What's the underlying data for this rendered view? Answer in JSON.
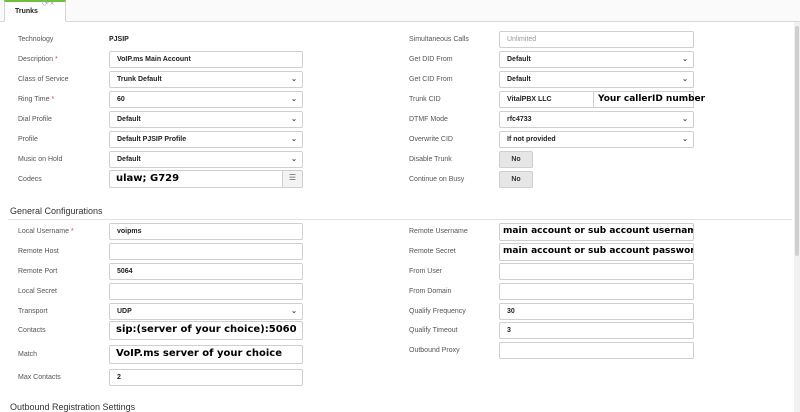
{
  "tab": {
    "label": "Trunks"
  },
  "left": {
    "technology": {
      "label": "Technology",
      "value": "PJSIP"
    },
    "description": {
      "label": "Description",
      "value": "VoIP.ms Main Account"
    },
    "class_of_service": {
      "label": "Class of Service",
      "value": "Trunk Default"
    },
    "ring_time": {
      "label": "Ring Time",
      "value": "60"
    },
    "dial_profile": {
      "label": "Dial Profile",
      "value": "Default"
    },
    "profile": {
      "label": "Profile",
      "value": "Default PJSIP Profile"
    },
    "music_on_hold": {
      "label": "Music on Hold",
      "value": "Default"
    },
    "codecs": {
      "label": "Codecs",
      "value": "ulaw; G729"
    }
  },
  "right": {
    "simultaneous_calls": {
      "label": "Simultaneous Calls",
      "placeholder": "Unlimited"
    },
    "get_did_from": {
      "label": "Get DID From",
      "value": "Default"
    },
    "get_cid_from": {
      "label": "Get CID From",
      "value": "Default"
    },
    "trunk_cid": {
      "label": "Trunk CID",
      "value": "VitalPBX LLC",
      "note": "Your callerID number"
    },
    "dtmf_mode": {
      "label": "DTMF Mode",
      "value": "rfc4733"
    },
    "overwrite_cid": {
      "label": "Overwrite CID",
      "value": "If not provided"
    },
    "disable_trunk": {
      "label": "Disable Trunk",
      "value": "No"
    },
    "continue_on_busy": {
      "label": "Continue on Busy",
      "value": "No"
    }
  },
  "general": {
    "title": "General Configurations",
    "local_username": {
      "label": "Local Username",
      "value": "voipms"
    },
    "remote_host": {
      "label": "Remote Host",
      "value": ""
    },
    "remote_port": {
      "label": "Remote Port",
      "value": "5064"
    },
    "local_secret": {
      "label": "Local Secret",
      "value": ""
    },
    "transport": {
      "label": "Transport",
      "value": "UDP"
    },
    "contacts": {
      "label": "Contacts",
      "value": "sip:(server of your choice):5060"
    },
    "match": {
      "label": "Match",
      "value": "VoIP.ms server of your choice"
    },
    "max_contacts": {
      "label": "Max Contacts",
      "value": "2"
    },
    "remote_username": {
      "label": "Remote Username",
      "value": "main account or sub account username"
    },
    "remote_secret": {
      "label": "Remote Secret",
      "value": "main account or sub account password"
    },
    "from_user": {
      "label": "From User",
      "value": ""
    },
    "from_domain": {
      "label": "From Domain",
      "value": ""
    },
    "qualify_frequency": {
      "label": "Qualify Frequency",
      "value": "30"
    },
    "qualify_timeout": {
      "label": "Qualify Timeout",
      "value": "3"
    },
    "outbound_proxy": {
      "label": "Outbound Proxy",
      "value": ""
    }
  },
  "outbound_registration": {
    "title": "Outbound Registration Settings"
  },
  "required_mark": "*",
  "icons": {
    "select_arrow": "chevron-down-icon",
    "list": "list-icon",
    "tab_refresh": "refresh-icon",
    "tab_close": "close-icon"
  }
}
